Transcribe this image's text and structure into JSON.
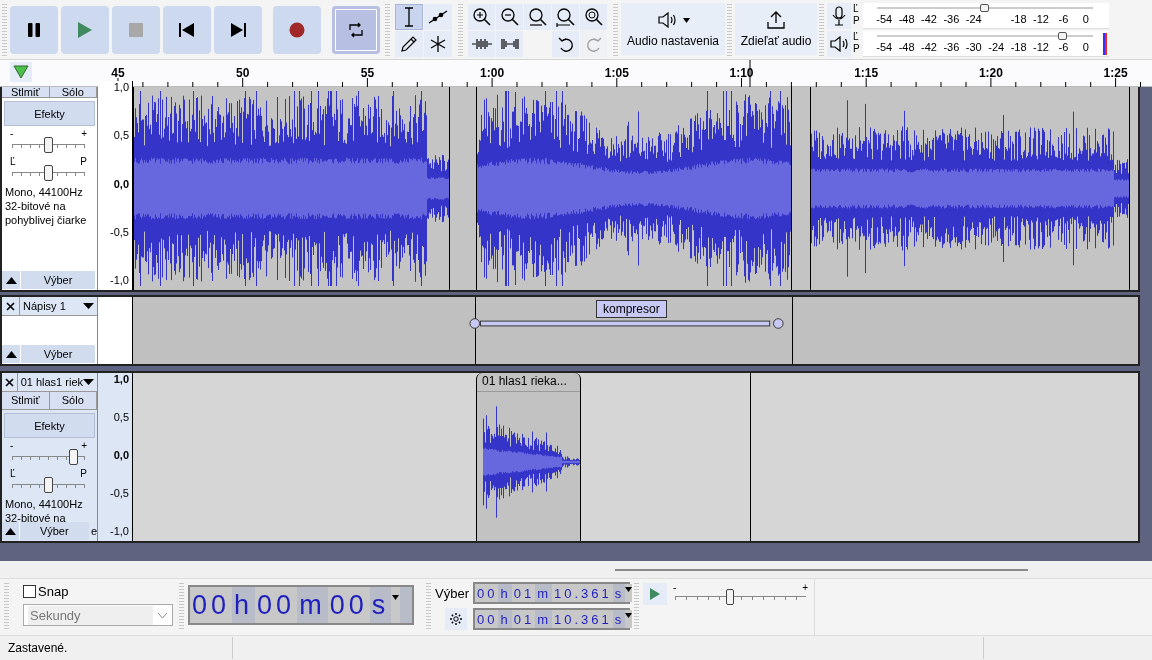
{
  "transport": {
    "loop": {
      "on": true
    }
  },
  "tools": [
    {
      "kind": "select",
      "selected": true
    },
    {
      "kind": "envelope",
      "selected": false
    },
    {
      "kind": "draw",
      "selected": false
    },
    {
      "kind": "multi",
      "selected": false
    }
  ],
  "audio_setup": {
    "label": "Audio nastavenia"
  },
  "share_audio": {
    "label": "Zdieľať audio"
  },
  "meters": [
    {
      "kind": "record",
      "channels": [
        "Ľ",
        "P"
      ],
      "scale": [
        "-54",
        "-48",
        "-42",
        "-36",
        "-24",
        "-18",
        "-12",
        "-6",
        "0"
      ],
      "level": 0.5
    },
    {
      "kind": "playback",
      "channels": [
        "Ľ",
        "P"
      ],
      "scale": [
        "-54",
        "-48",
        "-42",
        "-36",
        "-30",
        "-24",
        "-18",
        "-12",
        "-6",
        "0"
      ],
      "level": 0.86
    }
  ],
  "ruler": {
    "labels": [
      "45",
      "50",
      "55",
      "1:00",
      "1:05",
      "1:10",
      "1:15",
      "1:20",
      "1:25"
    ]
  },
  "tracks": [
    {
      "kind": "audio",
      "selected": false,
      "mute": "Stlmiť",
      "solo": "Sólo",
      "effects": "Efekty",
      "gain": {
        "minus": "-",
        "plus": "+",
        "level": 0.5
      },
      "pan": {
        "left": "Ľ",
        "right": "P",
        "level": 0.5
      },
      "info": [
        "Mono, 44100Hz",
        "32-bitové na",
        "pohyblivej čiarke"
      ],
      "select": "Výber",
      "scale": [
        "1,0",
        "0,5",
        "0,0",
        "-0,5",
        "-1,0"
      ]
    },
    {
      "kind": "label",
      "selected": false,
      "name": "Nápisy 1",
      "select": "Výber",
      "labels": [
        "kompresor"
      ]
    },
    {
      "kind": "audio",
      "selected": true,
      "name": "01 hlas1 riek",
      "mute": "Stlmiť",
      "solo": "Sólo",
      "effects": "Efekty",
      "gain": {
        "minus": "-",
        "plus": "+",
        "level": 0.85
      },
      "pan": {
        "left": "Ľ",
        "right": "P",
        "level": 0.5
      },
      "info": [
        "Mono, 44100Hz",
        "32-bitové na"
      ],
      "info_tail": "e",
      "select": "Výber",
      "scale": [
        "1,0",
        "0,5",
        "0,0",
        "-0,5",
        "-1,0"
      ],
      "clip_name": "01 hlas1 rieka..."
    }
  ],
  "snap": {
    "label": "Snap",
    "checked": false,
    "unit": "Sekundy"
  },
  "time": [
    "00",
    "h",
    "00",
    "m",
    "00",
    "s"
  ],
  "selection": {
    "label": "Výber",
    "start": [
      "00",
      "h",
      "01",
      "m",
      "10.361",
      "s"
    ],
    "end": [
      "00",
      "h",
      "01",
      "m",
      "10.361",
      "s"
    ]
  },
  "play_speed": {
    "minus": "-",
    "plus": "+",
    "level": 0.42
  },
  "status": "Zastavené."
}
